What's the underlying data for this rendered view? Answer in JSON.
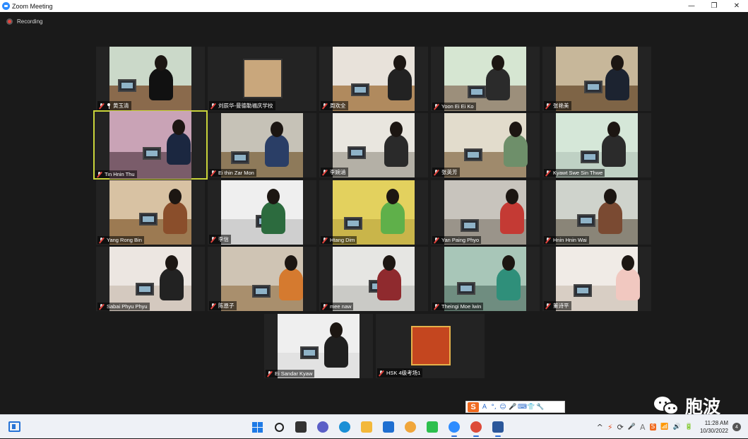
{
  "window": {
    "title": "Zoom Meeting",
    "controls": {
      "minimize": "—",
      "restore": "❐",
      "close": "✕"
    }
  },
  "recording": {
    "label": "Recording"
  },
  "participants": [
    {
      "name": "黄玉清",
      "pinned": true,
      "colors": [
        "#cbd9c9",
        "#8a6a4c",
        "#111111"
      ]
    },
    {
      "name": "刘辰华-曼德勒福庆学校",
      "avatar": true,
      "colors": [
        "#2a2a2a",
        "#c9a77c",
        "#333333"
      ]
    },
    {
      "name": "周欢全",
      "colors": [
        "#e8e2da",
        "#b08a5e",
        "#222222"
      ]
    },
    {
      "name": "Yoon Ei Ei Ko",
      "colors": [
        "#d6e6d2",
        "#9c8f7b",
        "#2b2b2b"
      ]
    },
    {
      "name": "张艳美",
      "colors": [
        "#c7b79a",
        "#7e6446",
        "#1c2330"
      ]
    },
    {
      "name": "Tin Hnin Thu",
      "active": true,
      "colors": [
        "#c9a3b6",
        "#7a5c6a",
        "#1b2740"
      ]
    },
    {
      "name": "Ei thin Zar Mon",
      "colors": [
        "#c6c2b7",
        "#8e7a5a",
        "#2a3e66"
      ]
    },
    {
      "name": "李婉涵",
      "colors": [
        "#e9e6df",
        "#b4b0a6",
        "#2a2a2a"
      ]
    },
    {
      "name": "张英芳",
      "colors": [
        "#e2dccc",
        "#9f8a6c",
        "#6e8f6a"
      ]
    },
    {
      "name": "Kyawt Swe Sin Thwe",
      "colors": [
        "#d5e7d8",
        "#bfd1c4",
        "#2b2b2b"
      ]
    },
    {
      "name": "Yang Rong Bin",
      "colors": [
        "#d8c2a3",
        "#9c7a52",
        "#8a4e2b"
      ]
    },
    {
      "name": "李信",
      "colors": [
        "#efefef",
        "#cfcfcf",
        "#2c6b3e"
      ]
    },
    {
      "name": "Htang Dim",
      "colors": [
        "#e3d15e",
        "#c9b54a",
        "#5fb04a"
      ]
    },
    {
      "name": "Yan Paing Phyo",
      "colors": [
        "#c8c4bd",
        "#9a948a",
        "#c43a34"
      ]
    },
    {
      "name": "Hnin Hnin Wai",
      "colors": [
        "#cfd3cc",
        "#8a8578",
        "#7a4a32"
      ]
    },
    {
      "name": "Sabai Phyu Phyu",
      "colors": [
        "#ece6e1",
        "#d4c9bf",
        "#222222"
      ]
    },
    {
      "name": "陈恩子",
      "colors": [
        "#cfc4b4",
        "#a98f6d",
        "#d57a2f"
      ]
    },
    {
      "name": "mee naw",
      "colors": [
        "#e6e6e3",
        "#cacac6",
        "#8f2a2e"
      ]
    },
    {
      "name": "Theingi Moe lwin",
      "colors": [
        "#a8c6b8",
        "#6f8d80",
        "#2f8f7a"
      ]
    },
    {
      "name": "董诗平",
      "colors": [
        "#f0ebe6",
        "#d8cec4",
        "#f1c8c0"
      ]
    },
    {
      "name": "Ei Sandar Kyaw",
      "colors": [
        "#efefef",
        "#e2e2e2",
        "#1f1f1f"
      ]
    },
    {
      "name": "HSK 4级考场1",
      "avatar": true,
      "colors": [
        "#2a2a2a",
        "#c4461f",
        "#e5b14a"
      ]
    }
  ],
  "ime_toolbar": {
    "logo": "S",
    "icons": [
      "A",
      "°,",
      "☺",
      "🎤",
      "⌨",
      "👕",
      "🔧"
    ]
  },
  "watermark": {
    "text": "胞波"
  },
  "taskbar": {
    "apps": [
      "start",
      "search",
      "task-view",
      "teams",
      "edge",
      "file-explorer",
      "mail",
      "browser",
      "wechat",
      "zoom",
      "chrome",
      "word"
    ],
    "active_apps": [
      "zoom",
      "chrome",
      "word"
    ],
    "tray_icons": [
      "^",
      "⚡",
      "⟳",
      "🎤",
      "A",
      "S",
      "📶",
      "🔊",
      "🔋"
    ],
    "time": "11:28 AM",
    "date": "10/30/2022",
    "notifications": "4"
  }
}
